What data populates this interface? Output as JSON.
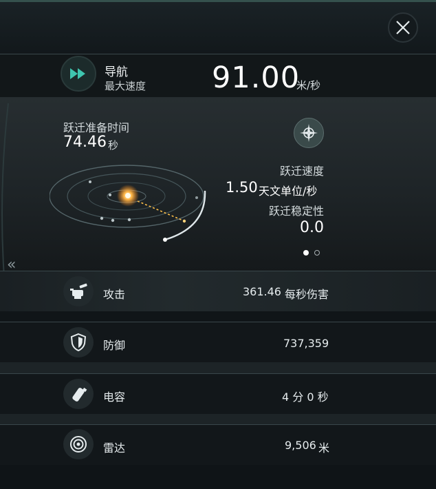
{
  "header": {
    "close_icon": "close-icon"
  },
  "navigation": {
    "icon": "fast-forward-icon",
    "title": "导航",
    "subtitle": "最大速度",
    "speed_value": "91.00",
    "speed_unit": "米/秒"
  },
  "warp": {
    "prep_label": "跃迁准备时间",
    "prep_value": "74.46",
    "prep_unit": "秒",
    "compass_icon": "compass-icon",
    "speed_label": "跃迁速度",
    "speed_value": "1.50",
    "speed_unit": "天文单位/秒",
    "stability_label": "跃迁稳定性",
    "stability_value": "0.0",
    "pager": {
      "pages": 2,
      "active": 1
    }
  },
  "side": {
    "collapse_arrow": "«"
  },
  "stats": [
    {
      "icon": "turret-icon",
      "label": "攻击",
      "value": "361.46",
      "unit": "每秒伤害"
    },
    {
      "icon": "shield-icon",
      "label": "防御",
      "value": "737,359",
      "unit": ""
    },
    {
      "icon": "capacitor-icon",
      "label": "电容",
      "value": "4 分 0 秒",
      "unit": ""
    },
    {
      "icon": "radar-icon",
      "label": "雷达",
      "value": "9,506",
      "unit": "米"
    }
  ],
  "colors": {
    "accent": "#3fc6b0",
    "background": "#0f1417",
    "panel": "#272e31"
  }
}
